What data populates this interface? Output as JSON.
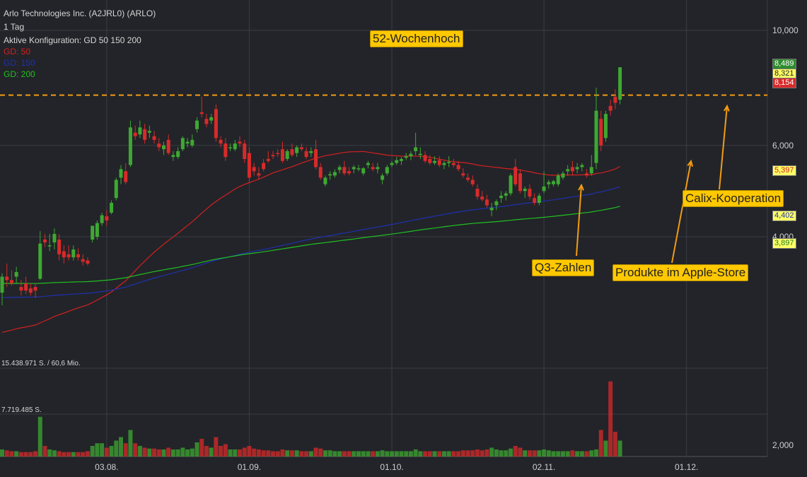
{
  "header": {
    "title": "Arlo Technologies Inc. (A2JRL0) (ARLO)",
    "period": "1 Tag",
    "config": "Aktive Konfiguration: GD 50 150 200",
    "legend": [
      {
        "label": "GD: 50",
        "color": "#d42020"
      },
      {
        "label": "GD: 150",
        "color": "#2030b0"
      },
      {
        "label": "GD: 200",
        "color": "#20c020"
      }
    ]
  },
  "colors": {
    "background": "#222429",
    "up": "#3ea832",
    "down": "#d92a2a",
    "grid": "#3a3d44",
    "dashed": "#f39c12",
    "callout": "#ffc800"
  },
  "annotations": {
    "high52": "52-Wochenhoch",
    "q3": "Q3-Zahlen",
    "apple": "Produkte im Apple-Store",
    "calix": "Calix-Kooperation"
  },
  "price_tags": {
    "last": "8,489",
    "mid": "8,321",
    "low": "8,154",
    "ma50": "5,397",
    "ma150": "4,402",
    "ma200": "3,897"
  },
  "volume_labels": {
    "top": "15.438.971 S. / 60,6 Mio.",
    "mid": "7.719.485 S."
  },
  "chart_data": [
    {
      "type": "candlestick",
      "title": "Arlo Technologies Inc. (A2JRL0) (ARLO)",
      "y_scale": "log",
      "ylim": [
        2.9,
        11.0
      ],
      "y_ticks": [
        {
          "value": 4,
          "label": "4,000"
        },
        {
          "value": 6,
          "label": "6,000"
        },
        {
          "value": 10,
          "label": "10,000"
        }
      ],
      "x_ticks": [
        {
          "index": 22,
          "label": "03.08."
        },
        {
          "index": 52,
          "label": "01.09."
        },
        {
          "index": 82,
          "label": "01.10."
        },
        {
          "index": 114,
          "label": "02.11."
        },
        {
          "index": 144,
          "label": "01.12."
        }
      ],
      "high_line": 7.5,
      "candles": [
        [
          3.12,
          3.4,
          2.95,
          3.35
        ],
        [
          3.35,
          3.55,
          3.2,
          3.3
        ],
        [
          3.3,
          3.45,
          3.22,
          3.25
        ],
        [
          3.35,
          3.5,
          3.25,
          3.42
        ],
        [
          3.2,
          3.3,
          3.08,
          3.15
        ],
        [
          3.25,
          3.35,
          3.1,
          3.15
        ],
        [
          3.18,
          3.25,
          3.08,
          3.12
        ],
        [
          3.2,
          3.25,
          3.05,
          3.15
        ],
        [
          3.32,
          4.1,
          3.3,
          3.88
        ],
        [
          3.95,
          4.05,
          3.82,
          3.9
        ],
        [
          3.85,
          4.05,
          3.75,
          3.85
        ],
        [
          3.9,
          4.15,
          3.78,
          4.05
        ],
        [
          3.95,
          4.05,
          3.6,
          3.7
        ],
        [
          3.75,
          3.85,
          3.55,
          3.65
        ],
        [
          3.7,
          3.85,
          3.6,
          3.65
        ],
        [
          3.65,
          3.85,
          3.6,
          3.78
        ],
        [
          3.7,
          3.8,
          3.6,
          3.65
        ],
        [
          3.62,
          3.7,
          3.52,
          3.58
        ],
        [
          3.6,
          3.65,
          3.52,
          3.55
        ],
        [
          3.95,
          4.05,
          3.9,
          4.2
        ],
        [
          4.0,
          4.3,
          3.95,
          4.25
        ],
        [
          4.25,
          4.45,
          4.2,
          4.4
        ],
        [
          4.38,
          4.5,
          4.2,
          4.3
        ],
        [
          4.45,
          4.7,
          4.42,
          4.65
        ],
        [
          4.75,
          5.2,
          4.7,
          5.15
        ],
        [
          5.2,
          5.5,
          5.05,
          5.4
        ],
        [
          5.35,
          5.55,
          5.05,
          5.1
        ],
        [
          5.5,
          6.7,
          5.45,
          6.5
        ],
        [
          6.35,
          6.55,
          6.15,
          6.25
        ],
        [
          6.3,
          6.7,
          6.2,
          6.5
        ],
        [
          6.45,
          6.6,
          6.05,
          6.15
        ],
        [
          6.35,
          6.55,
          6.2,
          6.4
        ],
        [
          6.25,
          6.4,
          6.05,
          6.15
        ],
        [
          6.05,
          6.2,
          5.85,
          5.95
        ],
        [
          5.9,
          6.1,
          5.75,
          6.0
        ],
        [
          6.15,
          6.3,
          5.75,
          5.8
        ],
        [
          5.7,
          5.85,
          5.6,
          5.75
        ],
        [
          5.7,
          5.95,
          5.65,
          5.85
        ],
        [
          5.9,
          6.25,
          5.85,
          6.2
        ],
        [
          6.05,
          6.2,
          5.95,
          6.1
        ],
        [
          6.0,
          6.3,
          5.95,
          6.15
        ],
        [
          6.45,
          6.8,
          6.35,
          6.7
        ],
        [
          6.95,
          7.45,
          6.8,
          6.9
        ],
        [
          6.75,
          6.9,
          6.5,
          6.6
        ],
        [
          6.7,
          6.9,
          6.6,
          6.8
        ],
        [
          7.05,
          7.2,
          6.1,
          6.2
        ],
        [
          6.15,
          6.25,
          5.95,
          6.05
        ],
        [
          6.05,
          6.2,
          5.6,
          5.7
        ],
        [
          5.95,
          6.05,
          5.85,
          5.95
        ],
        [
          5.9,
          6.15,
          5.85,
          6.05
        ],
        [
          6.1,
          6.25,
          5.95,
          6.05
        ],
        [
          6.05,
          6.15,
          5.55,
          5.65
        ],
        [
          5.8,
          5.95,
          5.1,
          5.2
        ],
        [
          5.45,
          5.55,
          5.25,
          5.35
        ],
        [
          5.3,
          5.45,
          5.15,
          5.25
        ],
        [
          5.55,
          5.65,
          5.35,
          5.4
        ],
        [
          5.65,
          5.85,
          5.55,
          5.6
        ],
        [
          5.75,
          5.85,
          5.65,
          5.72
        ],
        [
          5.8,
          5.9,
          5.7,
          5.78
        ],
        [
          5.9,
          6.1,
          5.55,
          5.6
        ],
        [
          5.65,
          5.9,
          5.6,
          5.85
        ],
        [
          5.9,
          6.05,
          5.7,
          5.75
        ],
        [
          5.8,
          6.0,
          5.7,
          5.95
        ],
        [
          5.95,
          6.05,
          5.85,
          5.9
        ],
        [
          5.85,
          5.95,
          5.65,
          5.7
        ],
        [
          5.8,
          5.95,
          5.7,
          5.85
        ],
        [
          5.9,
          6.15,
          5.4,
          5.45
        ],
        [
          5.45,
          5.55,
          5.15,
          5.2
        ],
        [
          5.05,
          5.25,
          5.0,
          5.2
        ],
        [
          5.25,
          5.35,
          5.15,
          5.28
        ],
        [
          5.25,
          5.4,
          5.2,
          5.33
        ],
        [
          5.38,
          5.5,
          5.3,
          5.45
        ],
        [
          5.45,
          5.6,
          5.25,
          5.3
        ],
        [
          5.35,
          5.45,
          5.25,
          5.3
        ],
        [
          5.4,
          5.5,
          5.3,
          5.45
        ],
        [
          5.4,
          5.5,
          5.35,
          5.42
        ],
        [
          5.3,
          5.45,
          5.25,
          5.42
        ],
        [
          5.5,
          5.6,
          5.42,
          5.55
        ],
        [
          5.45,
          5.55,
          5.35,
          5.4
        ],
        [
          5.4,
          5.55,
          5.3,
          5.45
        ],
        [
          5.15,
          5.3,
          5.05,
          5.25
        ],
        [
          5.3,
          5.5,
          5.25,
          5.45
        ],
        [
          5.5,
          5.6,
          5.45,
          5.55
        ],
        [
          5.55,
          5.7,
          5.5,
          5.62
        ],
        [
          5.6,
          5.7,
          5.5,
          5.65
        ],
        [
          5.68,
          5.8,
          5.62,
          5.72
        ],
        [
          5.72,
          5.85,
          5.62,
          5.78
        ],
        [
          5.85,
          6.35,
          5.75,
          5.95
        ],
        [
          5.75,
          5.95,
          5.65,
          5.78
        ],
        [
          5.75,
          5.85,
          5.55,
          5.6
        ],
        [
          5.65,
          5.75,
          5.5,
          5.55
        ],
        [
          5.55,
          5.72,
          5.5,
          5.6
        ],
        [
          5.62,
          5.72,
          5.45,
          5.5
        ],
        [
          5.5,
          5.6,
          5.4,
          5.55
        ],
        [
          5.55,
          5.72,
          5.45,
          5.58
        ],
        [
          5.55,
          5.65,
          5.45,
          5.5
        ],
        [
          5.5,
          5.6,
          5.35,
          5.4
        ],
        [
          5.3,
          5.42,
          5.2,
          5.25
        ],
        [
          5.2,
          5.3,
          5.1,
          5.15
        ],
        [
          5.15,
          5.25,
          5.0,
          5.05
        ],
        [
          4.95,
          5.05,
          4.72,
          4.78
        ],
        [
          4.78,
          4.9,
          4.68,
          4.72
        ],
        [
          4.72,
          4.82,
          4.55,
          4.6
        ],
        [
          4.5,
          4.65,
          4.38,
          4.55
        ],
        [
          4.6,
          4.72,
          4.5,
          4.68
        ],
        [
          4.75,
          4.9,
          4.65,
          4.8
        ],
        [
          4.8,
          4.9,
          4.7,
          4.85
        ],
        [
          4.85,
          5.3,
          4.8,
          5.25
        ],
        [
          5.45,
          5.65,
          5.0,
          5.05
        ],
        [
          5.3,
          5.4,
          4.85,
          4.9
        ],
        [
          4.9,
          5.0,
          4.75,
          4.95
        ],
        [
          4.95,
          5.05,
          4.72,
          4.78
        ],
        [
          4.75,
          4.85,
          4.6,
          4.65
        ],
        [
          4.65,
          4.85,
          4.6,
          4.8
        ],
        [
          4.9,
          5.35,
          4.85,
          5.0
        ],
        [
          5.05,
          5.15,
          4.95,
          5.1
        ],
        [
          5.05,
          5.15,
          5.0,
          5.12
        ],
        [
          5.05,
          5.3,
          5.0,
          5.25
        ],
        [
          5.2,
          5.35,
          5.15,
          5.3
        ],
        [
          5.35,
          5.5,
          5.25,
          5.4
        ],
        [
          5.45,
          5.6,
          5.25,
          5.35
        ],
        [
          5.4,
          5.55,
          5.3,
          5.45
        ],
        [
          5.45,
          5.55,
          5.35,
          5.5
        ],
        [
          5.3,
          5.4,
          5.2,
          5.25
        ],
        [
          5.3,
          5.75,
          5.25,
          5.45
        ],
        [
          5.55,
          7.75,
          5.4,
          7.0
        ],
        [
          6.75,
          7.0,
          5.85,
          6.0
        ],
        [
          6.2,
          7.0,
          6.1,
          6.9
        ],
        [
          7.15,
          7.35,
          6.85,
          7.0
        ],
        [
          7.45,
          7.7,
          7.05,
          7.25
        ],
        [
          7.35,
          8.45,
          7.2,
          8.49
        ]
      ],
      "volume_ticks": [
        {
          "value": 2000000,
          "label": "2,000"
        }
      ],
      "volume_max": 15438971
    }
  ]
}
